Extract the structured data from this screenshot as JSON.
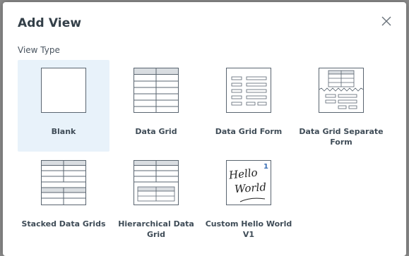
{
  "dialog": {
    "title": "Add View",
    "close_icon": "close-icon",
    "section_label": "View Type"
  },
  "view_types": [
    {
      "label": "Blank",
      "icon": "blank-view-icon",
      "selected": true
    },
    {
      "label": "Data Grid",
      "icon": "data-grid-icon",
      "selected": false
    },
    {
      "label": "Data Grid Form",
      "icon": "data-grid-form-icon",
      "selected": false
    },
    {
      "label": "Data Grid Separate Form",
      "icon": "data-grid-separate-form-icon",
      "selected": false
    },
    {
      "label": "Stacked Data Grids",
      "icon": "stacked-data-grids-icon",
      "selected": false
    },
    {
      "label": "Hierarchical Data Grid",
      "icon": "hierarchical-data-grid-icon",
      "selected": false
    },
    {
      "label": "Custom Hello World V1",
      "icon": "custom-hello-world-icon",
      "selected": false,
      "thumb_text_1": "Hello",
      "thumb_text_2": "World",
      "thumb_superscript": "1"
    }
  ],
  "colors": {
    "selected_bg": "#e8f2fa",
    "thumb_stroke": "#5a6570",
    "thumb_header": "#d9dde1",
    "superscript": "#3a6fb5"
  }
}
